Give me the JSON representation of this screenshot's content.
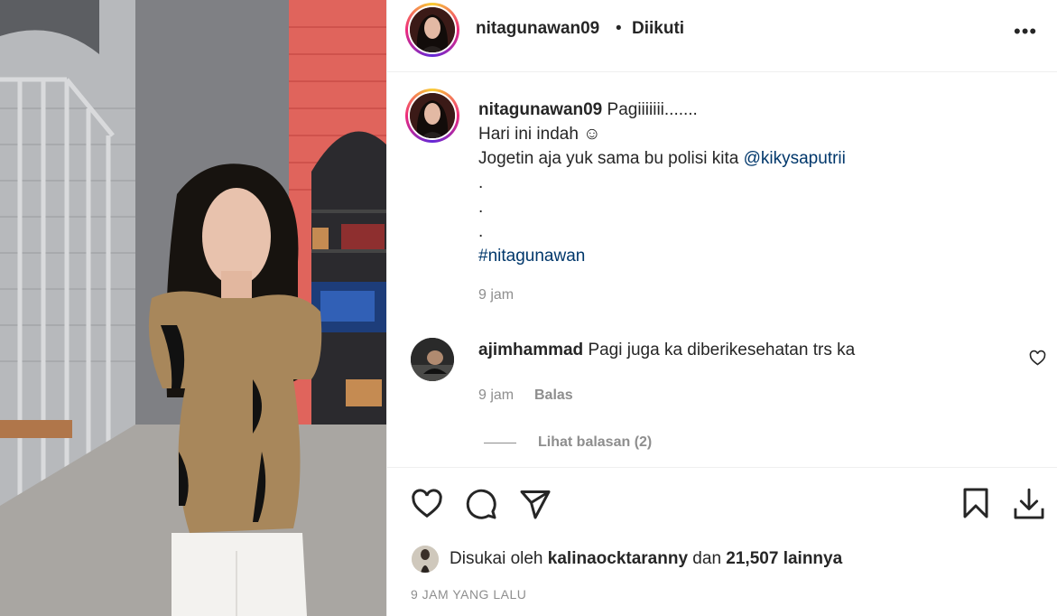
{
  "post": {
    "author": "nitagunawan09",
    "separator": "•",
    "follow_status": "Diikuti",
    "more_icon": "•••"
  },
  "caption": {
    "username": "nitagunawan09",
    "line1": "Pagiiiiiii.......",
    "line2": "Hari ini indah ☺",
    "line3_prefix": "Jogetin aja yuk sama bu polisi kita ",
    "mention": "@kikysaputrii",
    "dot1": ".",
    "dot2": ".",
    "dot3": ".",
    "hashtag": "#nitagunawan",
    "time": "9 jam"
  },
  "comment": {
    "username": "ajimhammad",
    "text": "Pagi juga ka diberikesehatan trs ka",
    "time": "9 jam",
    "reply_label": "Balas",
    "view_replies": "Lihat balasan (2)"
  },
  "likes": {
    "prefix": "Disukai oleh ",
    "liker": "kalinaocktaranny",
    "middle": " dan ",
    "count": "21,507 lainnya"
  },
  "posted_ago": "9 JAM YANG LALU",
  "colors": {
    "link": "#00376b",
    "muted": "#8e8e8e",
    "text": "#262626"
  }
}
